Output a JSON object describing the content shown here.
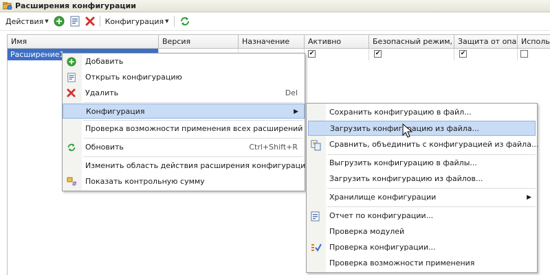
{
  "window": {
    "title": "Расширения конфигурации"
  },
  "toolbar": {
    "actions_label": "Действия",
    "config_label": "Конфигурация"
  },
  "table": {
    "columns": [
      "Имя",
      "Версия",
      "Назначение",
      "Активно",
      "Безопасный режим, ...",
      "Защита от опа...",
      "Использ"
    ],
    "rows": [
      {
        "name": "Расширение1",
        "active": true,
        "safe_mode": true,
        "protection": true,
        "use": false
      }
    ]
  },
  "context_menu": {
    "items": [
      {
        "label": "Добавить",
        "icon": "add-icon"
      },
      {
        "label": "Открыть конфигурацию",
        "icon": "open-config-icon"
      },
      {
        "label": "Удалить",
        "icon": "delete-icon",
        "shortcut": "Del"
      },
      {
        "label": "Конфигурация",
        "submenu": true,
        "highlighted": true
      },
      {
        "label": "Проверка возможности применения всех расширений"
      },
      {
        "label": "Обновить",
        "icon": "refresh-icon",
        "shortcut": "Ctrl+Shift+R"
      },
      {
        "label": "Изменить область действия расширения конфигурации"
      },
      {
        "label": "Показать контрольную сумму",
        "icon": "checksum-icon"
      }
    ]
  },
  "submenu": {
    "items": [
      {
        "label": "Сохранить конфигурацию в файл..."
      },
      {
        "label": "Загрузить конфигурацию из файла...",
        "highlighted": true
      },
      {
        "label": "Сравнить, объединить с конфигурацией из файла...",
        "icon": "compare-icon"
      },
      {
        "label": "Выгрузить конфигурацию в файлы..."
      },
      {
        "label": "Загрузить конфигурацию из файлов..."
      },
      {
        "label": "Хранилище конфигурации",
        "submenu": true
      },
      {
        "label": "Отчет по конфигурации...",
        "icon": "report-icon"
      },
      {
        "label": "Проверка модулей"
      },
      {
        "label": "Проверка конфигурации...",
        "icon": "check-config-icon"
      },
      {
        "label": "Проверка возможности применения"
      }
    ]
  },
  "colors": {
    "selection": "#3d6fc4",
    "menu_highlight": "#c9dcf5",
    "add_green": "#3aa43a",
    "delete_red": "#d0342c"
  }
}
